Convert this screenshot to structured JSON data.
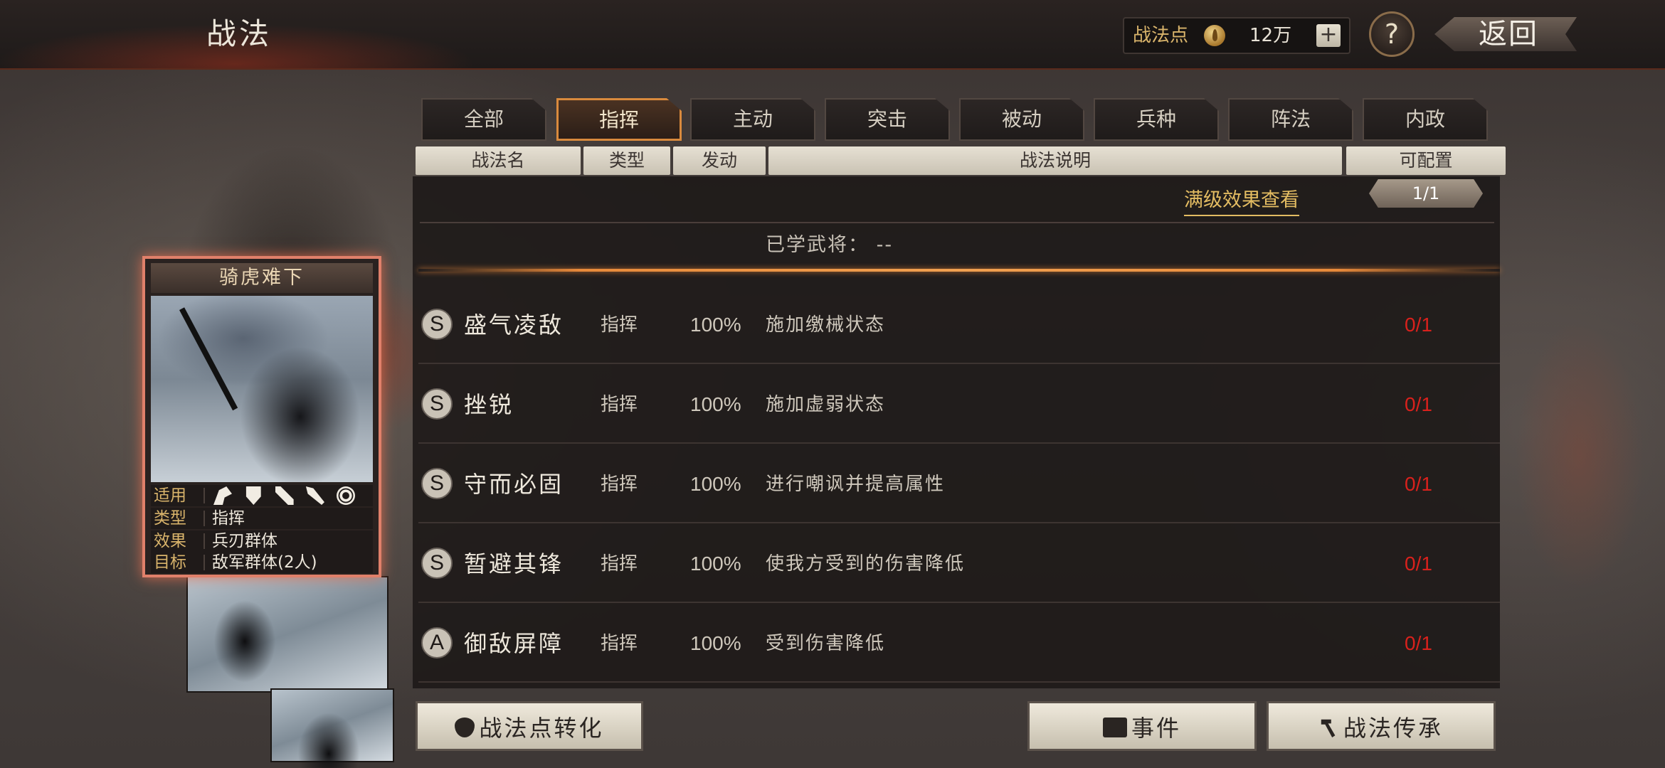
{
  "header": {
    "title": "战法",
    "points_label": "战法点",
    "points_value": "12万",
    "plus_label": "+",
    "help_label": "?",
    "back_label": "返回"
  },
  "tabs": [
    {
      "label": "全部",
      "active": false
    },
    {
      "label": "指挥",
      "active": true
    },
    {
      "label": "主动",
      "active": false
    },
    {
      "label": "突击",
      "active": false
    },
    {
      "label": "被动",
      "active": false
    },
    {
      "label": "兵种",
      "active": false
    },
    {
      "label": "阵法",
      "active": false
    },
    {
      "label": "内政",
      "active": false
    }
  ],
  "columns": {
    "name": "战法名",
    "type": "类型",
    "trigger": "发动",
    "desc": "战法说明",
    "config": "可配置"
  },
  "panel": {
    "maxlevel_link": "满级效果查看",
    "page": "1/1",
    "learned_label": "已学武将：  --"
  },
  "skills": [
    {
      "grade": "S",
      "name": "盛气凌敌",
      "type": "指挥",
      "rate": "100%",
      "desc": "施加缴械状态",
      "config": "0/1"
    },
    {
      "grade": "S",
      "name": "挫锐",
      "type": "指挥",
      "rate": "100%",
      "desc": "施加虚弱状态",
      "config": "0/1"
    },
    {
      "grade": "S",
      "name": "守而必固",
      "type": "指挥",
      "rate": "100%",
      "desc": "进行嘲讽并提高属性",
      "config": "0/1"
    },
    {
      "grade": "S",
      "name": "暂避其锋",
      "type": "指挥",
      "rate": "100%",
      "desc": "使我方受到的伤害降低",
      "config": "0/1"
    },
    {
      "grade": "A",
      "name": "御敌屏障",
      "type": "指挥",
      "rate": "100%",
      "desc": "受到伤害降低",
      "config": "0/1"
    }
  ],
  "card": {
    "title": "骑虎难下",
    "apply_label": "适用",
    "apply_icons": [
      "horse-icon",
      "shield-icon",
      "bow-icon",
      "spear-icon",
      "wheel-icon"
    ],
    "type_label": "类型",
    "type_value": "指挥",
    "effect_label": "效果",
    "effect_value": "兵刃群体",
    "target_label": "目标",
    "target_value": "敌军群体(2人)"
  },
  "buttons": {
    "convert": "战法点转化",
    "event": "事件",
    "inherit": "战法传承"
  },
  "colors": {
    "accent_orange": "#e8893a",
    "gold": "#e3bc62",
    "config_red": "#d9211c"
  }
}
